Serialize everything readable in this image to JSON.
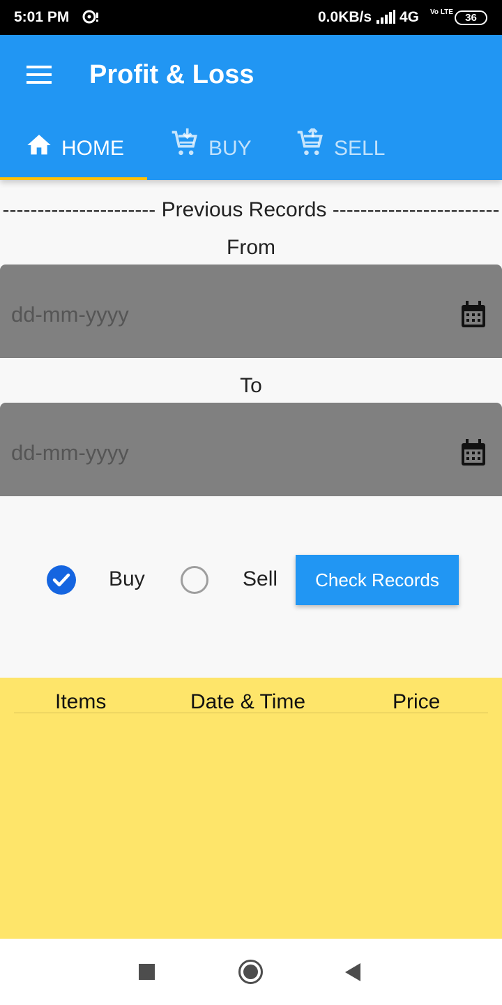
{
  "status_bar": {
    "time": "5:01 PM",
    "speed": "0.0KB/s",
    "network": "4G",
    "volte": "Vo LTE",
    "battery": "36"
  },
  "app_bar": {
    "title": "Profit & Loss",
    "menu_icon": "menu-icon"
  },
  "tabs": [
    {
      "label": "HOME",
      "icon": "home-icon",
      "selected": true
    },
    {
      "label": "BUY",
      "icon": "cart-download-icon",
      "selected": false
    },
    {
      "label": "SELL",
      "icon": "cart-upload-icon",
      "selected": false
    }
  ],
  "records": {
    "heading": "---------------------- Previous Records ------------------------",
    "from_label": "From",
    "from_placeholder": "dd-mm-yyyy",
    "to_label": "To",
    "to_placeholder": "dd-mm-yyyy",
    "buy_label": "Buy",
    "buy_checked": true,
    "sell_label": "Sell",
    "sell_checked": false,
    "check_button": "Check Records"
  },
  "table": {
    "columns": [
      "Items",
      "Date & Time",
      "Price"
    ],
    "rows": []
  },
  "colors": {
    "primary": "#2196f3",
    "tab_indicator": "#ffc107",
    "date_field": "#808080",
    "table_bg": "#fee56a",
    "checkbox": "#1565e0"
  }
}
